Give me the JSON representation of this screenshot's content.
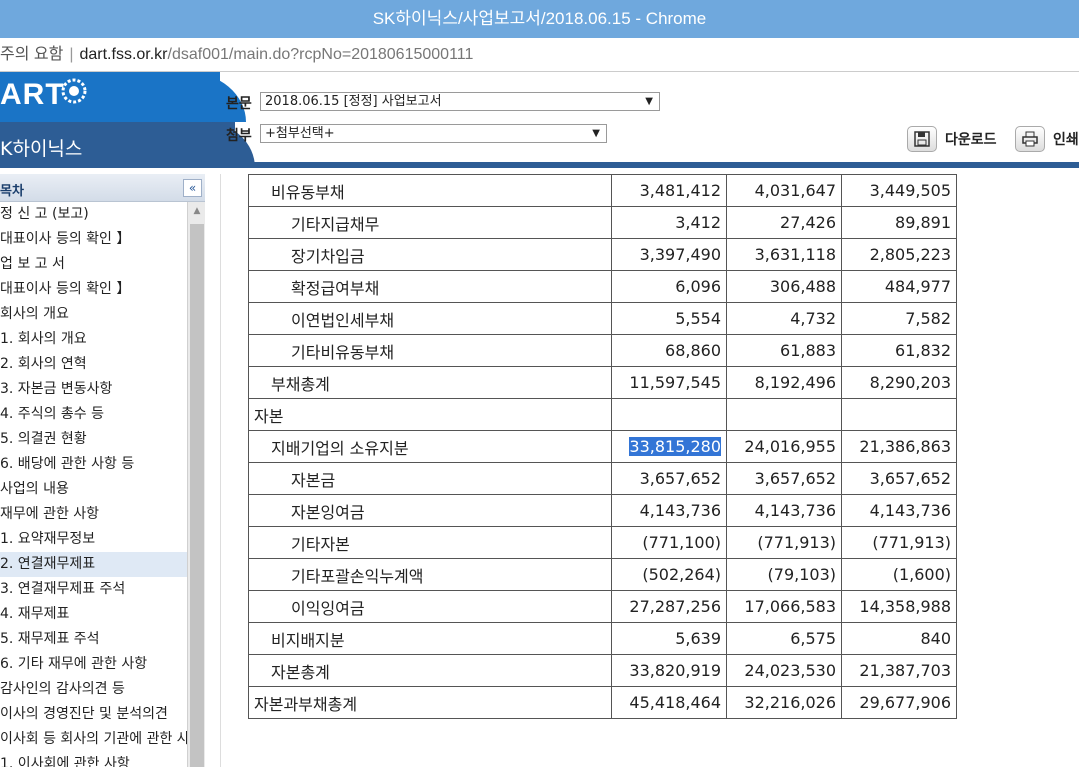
{
  "window": {
    "title": "SK하이닉스/사업보고서/2018.06.15 - Chrome"
  },
  "address": {
    "warning": "주의 요함",
    "host": "dart.fss.or.kr",
    "path": "/dsaf001/main.do?rcpNo=20180615000111"
  },
  "header": {
    "logo": "ART",
    "company": "K하이닉스",
    "body_label": "본문",
    "body_select": "2018.06.15  [정정] 사업보고서",
    "attach_label": "첨부",
    "attach_select": "+첨부선택+",
    "download_label": "다운로드",
    "print_label": "인쇄"
  },
  "sidebar": {
    "title": "목차",
    "collapse": "«",
    "items": [
      "정 신 고 (보고)",
      "대표이사 등의 확인 】",
      "업 보 고 서",
      "대표이사 등의 확인 】",
      "회사의 개요",
      " 1. 회사의 개요",
      " 2. 회사의 연혁",
      " 3. 자본금 변동사항",
      " 4. 주식의 총수 등",
      " 5. 의결권 현황",
      " 6. 배당에 관한 사항 등",
      "사업의 내용",
      " 재무에 관한 사항",
      " 1. 요약재무정보",
      " 2. 연결재무제표",
      " 3. 연결재무제표 주석",
      " 4. 재무제표",
      " 5. 재무제표 주석",
      " 6. 기타 재무에 관한 사항",
      " 감사인의 감사의견 등",
      "이사의 경영진단 및 분석의견",
      " 이사회 등 회사의 기관에 관한 사항",
      " 1. 이사회에 관한 사항"
    ],
    "selected_index": 14
  },
  "table": {
    "rows": [
      {
        "label": "비유동부채",
        "indent": 1,
        "v": [
          "3,481,412",
          "4,031,647",
          "3,449,505"
        ]
      },
      {
        "label": "기타지급채무",
        "indent": 2,
        "v": [
          "3,412",
          "27,426",
          "89,891"
        ]
      },
      {
        "label": "장기차입금",
        "indent": 2,
        "v": [
          "3,397,490",
          "3,631,118",
          "2,805,223"
        ]
      },
      {
        "label": "확정급여부채",
        "indent": 2,
        "v": [
          "6,096",
          "306,488",
          "484,977"
        ]
      },
      {
        "label": "이연법인세부채",
        "indent": 2,
        "v": [
          "5,554",
          "4,732",
          "7,582"
        ]
      },
      {
        "label": "기타비유동부채",
        "indent": 2,
        "v": [
          "68,860",
          "61,883",
          "61,832"
        ]
      },
      {
        "label": "부채총계",
        "indent": 1,
        "v": [
          "11,597,545",
          "8,192,496",
          "8,290,203"
        ]
      },
      {
        "label": "자본",
        "indent": 0,
        "v": [
          "",
          "",
          ""
        ]
      },
      {
        "label": "지배기업의 소유지분",
        "indent": 1,
        "v": [
          "33,815,280",
          "24,016,955",
          "21,386,863"
        ]
      },
      {
        "label": "자본금",
        "indent": 2,
        "v": [
          "3,657,652",
          "3,657,652",
          "3,657,652"
        ]
      },
      {
        "label": "자본잉여금",
        "indent": 2,
        "v": [
          "4,143,736",
          "4,143,736",
          "4,143,736"
        ]
      },
      {
        "label": "기타자본",
        "indent": 2,
        "v": [
          "(771,100)",
          "(771,913)",
          "(771,913)"
        ]
      },
      {
        "label": "기타포괄손익누계액",
        "indent": 2,
        "v": [
          "(502,264)",
          "(79,103)",
          "(1,600)"
        ]
      },
      {
        "label": "이익잉여금",
        "indent": 2,
        "v": [
          "27,287,256",
          "17,066,583",
          "14,358,988"
        ]
      },
      {
        "label": "비지배지분",
        "indent": 1,
        "v": [
          "5,639",
          "6,575",
          "840"
        ]
      },
      {
        "label": "자본총계",
        "indent": 1,
        "v": [
          "33,820,919",
          "24,023,530",
          "21,387,703"
        ]
      },
      {
        "label": "자본과부채총계",
        "indent": 0,
        "v": [
          "45,418,464",
          "32,216,026",
          "29,677,906"
        ]
      }
    ],
    "highlighted": {
      "row": 8,
      "col": 0
    }
  },
  "colors": {
    "titlebar": "#6fa8dd",
    "brand_blue": "#1a74c6",
    "brand_dark": "#2d5d95",
    "selection": "#3375d6"
  }
}
